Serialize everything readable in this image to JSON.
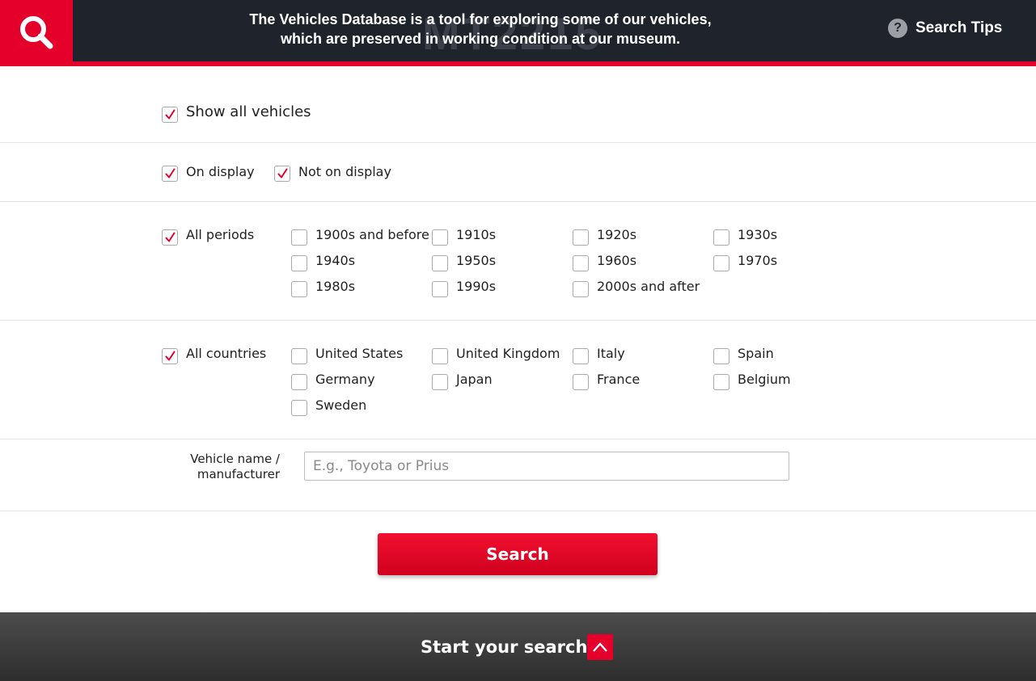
{
  "header": {
    "background_code": "MT2215",
    "tagline_line1": "The Vehicles Database is a tool for exploring some of our vehicles,",
    "tagline_line2": "which are preserved in working condition at our museum.",
    "search_tips_icon": "?",
    "search_tips_label": "Search Tips",
    "icon": "search-icon"
  },
  "colors": {
    "brand_red": "#e4002b",
    "header_bg": "#1f232c",
    "footer_bg": "#3a3a3a"
  },
  "filters": {
    "show_all": {
      "label": "Show all vehicles",
      "checked": true
    },
    "display": [
      {
        "label": "On display",
        "checked": true
      },
      {
        "label": "Not on display",
        "checked": true
      }
    ],
    "periods": {
      "all": {
        "label": "All periods",
        "checked": true
      },
      "options": [
        {
          "label": "1900s and before",
          "checked": false
        },
        {
          "label": "1910s",
          "checked": false
        },
        {
          "label": "1920s",
          "checked": false
        },
        {
          "label": "1930s",
          "checked": false
        },
        {
          "label": "1940s",
          "checked": false
        },
        {
          "label": "1950s",
          "checked": false
        },
        {
          "label": "1960s",
          "checked": false
        },
        {
          "label": "1970s",
          "checked": false
        },
        {
          "label": "1980s",
          "checked": false
        },
        {
          "label": "1990s",
          "checked": false
        },
        {
          "label": "2000s and after",
          "checked": false
        }
      ]
    },
    "countries": {
      "all": {
        "label": "All countries",
        "checked": true
      },
      "options": [
        {
          "label": "United States",
          "checked": false
        },
        {
          "label": "United Kingdom",
          "checked": false
        },
        {
          "label": "Italy",
          "checked": false
        },
        {
          "label": "Spain",
          "checked": false
        },
        {
          "label": "Germany",
          "checked": false
        },
        {
          "label": "Japan",
          "checked": false
        },
        {
          "label": "France",
          "checked": false
        },
        {
          "label": "Belgium",
          "checked": false
        },
        {
          "label": "Sweden",
          "checked": false
        }
      ]
    }
  },
  "name_field": {
    "label_line1": "Vehicle name /",
    "label_line2": "manufacturer",
    "value": "",
    "placeholder": "E.g., Toyota or Prius"
  },
  "search_button": {
    "label": "Search"
  },
  "footer": {
    "label": "Start your search",
    "icon": "chevron-up-icon"
  }
}
